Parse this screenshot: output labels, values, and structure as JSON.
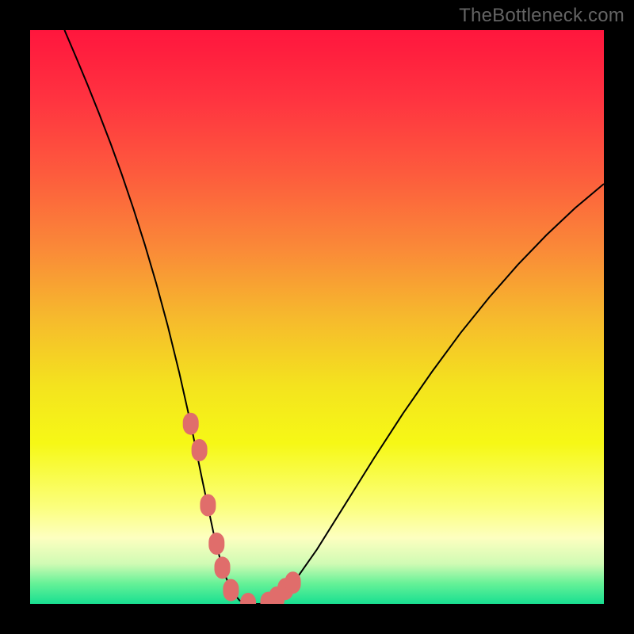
{
  "attribution": "TheBottleneck.com",
  "colors": {
    "page_bg": "#000000",
    "attribution_fg": "#646464",
    "curve": "#000000",
    "marker_fill": "#e06d6b",
    "gradient_stops": [
      {
        "offset": 0.0,
        "color": "#ff163d"
      },
      {
        "offset": 0.12,
        "color": "#ff3340"
      },
      {
        "offset": 0.25,
        "color": "#fd5b3d"
      },
      {
        "offset": 0.38,
        "color": "#fa8938"
      },
      {
        "offset": 0.5,
        "color": "#f6b92d"
      },
      {
        "offset": 0.62,
        "color": "#f4e31e"
      },
      {
        "offset": 0.72,
        "color": "#f6f816"
      },
      {
        "offset": 0.83,
        "color": "#fbff7c"
      },
      {
        "offset": 0.885,
        "color": "#fdffc0"
      },
      {
        "offset": 0.93,
        "color": "#d0fbb4"
      },
      {
        "offset": 0.965,
        "color": "#64f197"
      },
      {
        "offset": 1.0,
        "color": "#18df91"
      }
    ]
  },
  "chart_data": {
    "type": "line",
    "title": "",
    "xlabel": "",
    "ylabel": "",
    "xlim": [
      0,
      100
    ],
    "ylim": [
      0,
      100
    ],
    "series": [
      {
        "name": "curve",
        "x": [
          6,
          8,
          10,
          12,
          14,
          16,
          18,
          20,
          22,
          24,
          26,
          28,
          30,
          32,
          33.5,
          35,
          36.5,
          38,
          40,
          42,
          44,
          46,
          50,
          55,
          60,
          65,
          70,
          75,
          80,
          85,
          90,
          95,
          100
        ],
        "values": [
          100,
          95.3,
          90.5,
          85.5,
          80.3,
          74.8,
          68.9,
          62.6,
          55.8,
          48.4,
          40.3,
          31.4,
          21.6,
          12.2,
          6.3,
          2.4,
          0.6,
          0.0,
          0.0,
          0.4,
          1.7,
          3.8,
          9.5,
          17.5,
          25.5,
          33.2,
          40.4,
          47.2,
          53.4,
          59.1,
          64.3,
          69.0,
          73.2
        ]
      }
    ],
    "markers": {
      "name": "highlight-cluster",
      "x": [
        28.0,
        29.5,
        31.0,
        32.5,
        33.5,
        35.0,
        38.0,
        41.5,
        43.0,
        44.5,
        45.8
      ],
      "values": [
        31.4,
        26.8,
        17.2,
        10.5,
        6.3,
        2.4,
        0.0,
        0.2,
        1.1,
        2.6,
        3.7
      ]
    },
    "grid": false,
    "legend": false
  }
}
